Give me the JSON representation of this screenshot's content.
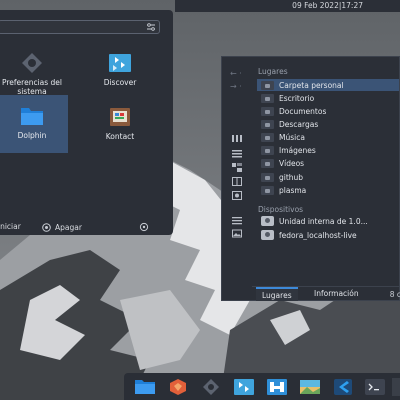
{
  "topbar": {
    "clock": "09 Feb 2022|17:27"
  },
  "launcher": {
    "apps": [
      {
        "label": "Preferencias del sistema",
        "icon": "system-settings-icon"
      },
      {
        "label": "Discover",
        "icon": "discover-icon"
      },
      {
        "label": "Dolphin",
        "icon": "dolphin-folder-icon"
      },
      {
        "label": "Kontact",
        "icon": "kontact-icon"
      }
    ],
    "footer": {
      "restart": "iniciar",
      "shutdown": "Apagar"
    }
  },
  "places": {
    "header": "Lugares",
    "items": [
      {
        "label": "Carpeta personal",
        "active": true
      },
      {
        "label": "Escritorio"
      },
      {
        "label": "Documentos"
      },
      {
        "label": "Descargas"
      },
      {
        "label": "Música"
      },
      {
        "label": "Imágenes"
      },
      {
        "label": "Vídeos"
      },
      {
        "label": "github"
      },
      {
        "label": "plasma"
      }
    ],
    "devices_header": "Dispositivos",
    "devices": [
      {
        "label": "Unidad interna de 1.0..."
      },
      {
        "label": "fedora_localhost-live"
      }
    ],
    "tabs": [
      {
        "label": "Lugares",
        "active": true
      },
      {
        "label": "Información"
      }
    ],
    "count": "8 c"
  },
  "dock": {
    "items": [
      "dolphin-icon",
      "firefox-icon",
      "system-settings-icon",
      "discover-icon",
      "kontact-icon",
      "image-viewer-icon",
      "vscode-icon",
      "terminal-icon"
    ]
  },
  "colors": {
    "accent": "#3d89d8",
    "selection": "#3b5476",
    "panel": "#2b2f37"
  }
}
